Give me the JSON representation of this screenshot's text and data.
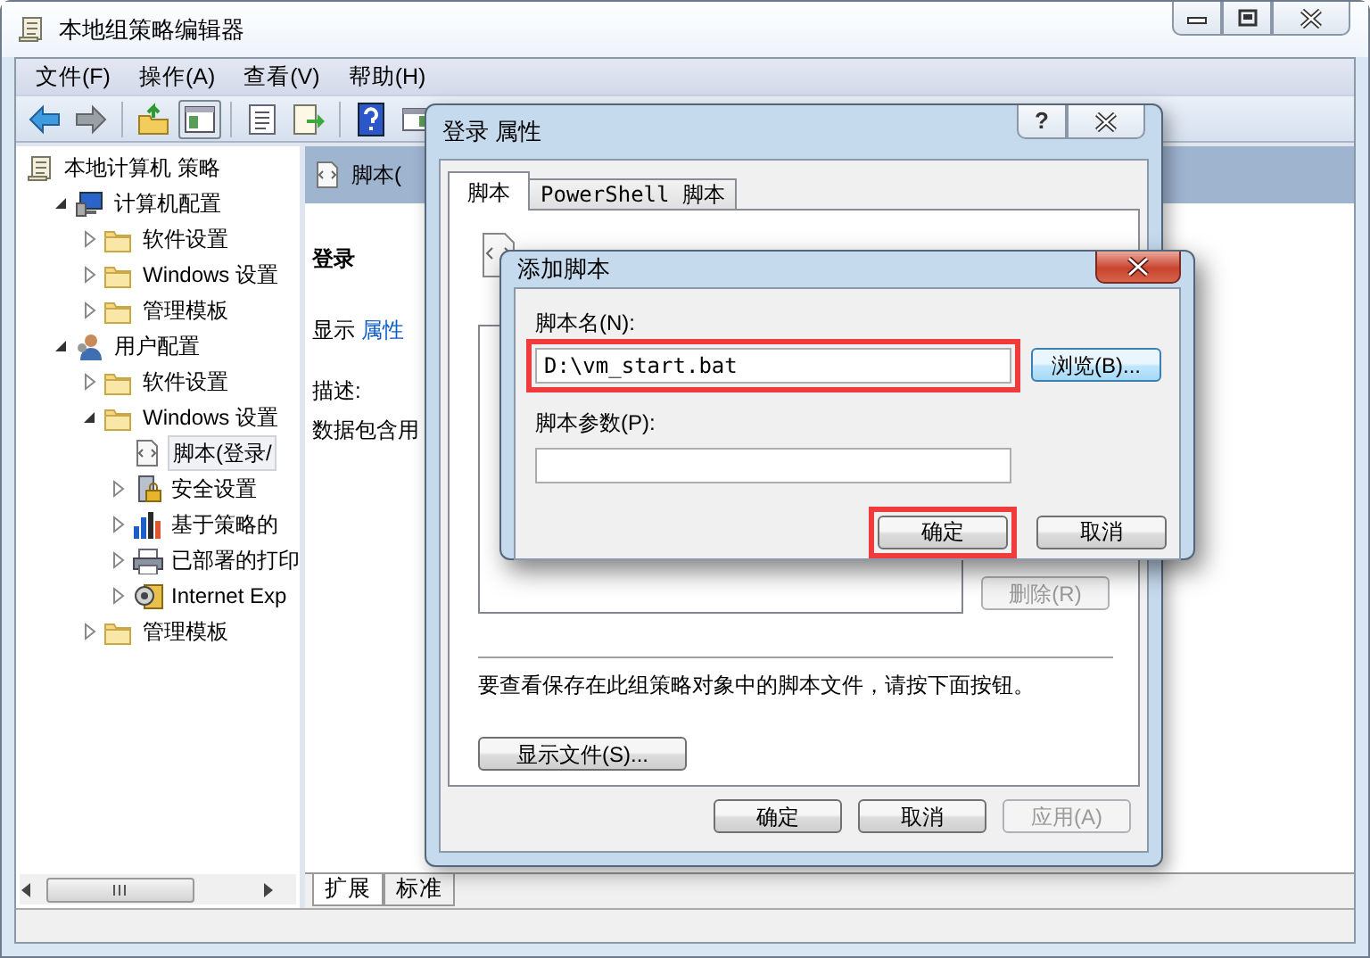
{
  "window": {
    "title": "本地组策略编辑器"
  },
  "menu": [
    "文件(F)",
    "操作(A)",
    "查看(V)",
    "帮助(H)"
  ],
  "toolbar": [
    {
      "kind": "back",
      "pressed": false
    },
    {
      "kind": "forward",
      "pressed": false
    },
    {
      "kind": "up",
      "pressed": false
    },
    {
      "kind": "tree",
      "pressed": true
    },
    {
      "kind": "props",
      "pressed": false
    },
    {
      "kind": "export",
      "pressed": false
    },
    {
      "kind": "help",
      "pressed": false
    },
    {
      "kind": "view",
      "pressed": false
    }
  ],
  "tree": {
    "label": "本地计算机 策略",
    "kind": "scroll",
    "selected": false,
    "children": [
      {
        "label": "计算机配置",
        "kind": "computer",
        "expanded": true,
        "selected": false,
        "children": [
          {
            "label": "软件设置",
            "kind": "folder",
            "expanded": false,
            "selected": false
          },
          {
            "label": "Windows 设置",
            "kind": "folder",
            "expanded": false,
            "selected": false
          },
          {
            "label": "管理模板",
            "kind": "folder",
            "expanded": false,
            "selected": false
          }
        ]
      },
      {
        "label": "用户配置",
        "kind": "user",
        "expanded": true,
        "selected": false,
        "children": [
          {
            "label": "软件设置",
            "kind": "folder",
            "expanded": false,
            "selected": false
          },
          {
            "label": "Windows 设置",
            "kind": "folder",
            "expanded": true,
            "selected": false,
            "children": [
              {
                "label": "脚本(登录/",
                "kind": "script",
                "selected": true
              },
              {
                "label": "安全设置",
                "kind": "security",
                "expanded": false,
                "selected": false
              },
              {
                "label": "基于策略的",
                "kind": "chart",
                "expanded": false,
                "selected": false
              },
              {
                "label": "已部署的打印",
                "kind": "printer",
                "expanded": false,
                "selected": false
              },
              {
                "label": "Internet Exp",
                "kind": "ie",
                "expanded": false,
                "selected": false
              }
            ]
          },
          {
            "label": "管理模板",
            "kind": "folder",
            "expanded": false,
            "selected": false
          }
        ]
      }
    ]
  },
  "detail": {
    "header": "脚本(",
    "title": "登录",
    "show_label": "显示",
    "show_link": "属性",
    "description_label": "描述:",
    "description": "数据包含用"
  },
  "bottom_tabs": [
    {
      "label": "扩展",
      "selected": true
    },
    {
      "label": "标准",
      "selected": false
    }
  ],
  "properties_dialog": {
    "title": "登录 属性",
    "help": "?",
    "tabs": [
      {
        "label": "脚本",
        "selected": true
      },
      {
        "label": "PowerShell 脚本",
        "selected": false
      }
    ],
    "remove_button": {
      "label": "删除(R)",
      "disabled": true
    },
    "note": "要查看保存在此组策略对象中的脚本文件，请按下面按钮。",
    "show_files_button": "显示文件(S)...",
    "buttons": [
      {
        "label": "确定",
        "disabled": false
      },
      {
        "label": "取消",
        "disabled": false
      },
      {
        "label": "应用(A)",
        "disabled": true
      }
    ]
  },
  "add_dialog": {
    "title": "添加脚本",
    "fields": [
      {
        "label": "脚本名(N):",
        "value": "D:\\vm_start.bat",
        "highlighted": true
      },
      {
        "label": "脚本参数(P):",
        "highlighted": false
      }
    ],
    "browse_button": "浏览(B)...",
    "buttons": [
      {
        "label": "确定",
        "highlighted": true
      },
      {
        "label": "取消",
        "highlighted": false
      }
    ]
  }
}
